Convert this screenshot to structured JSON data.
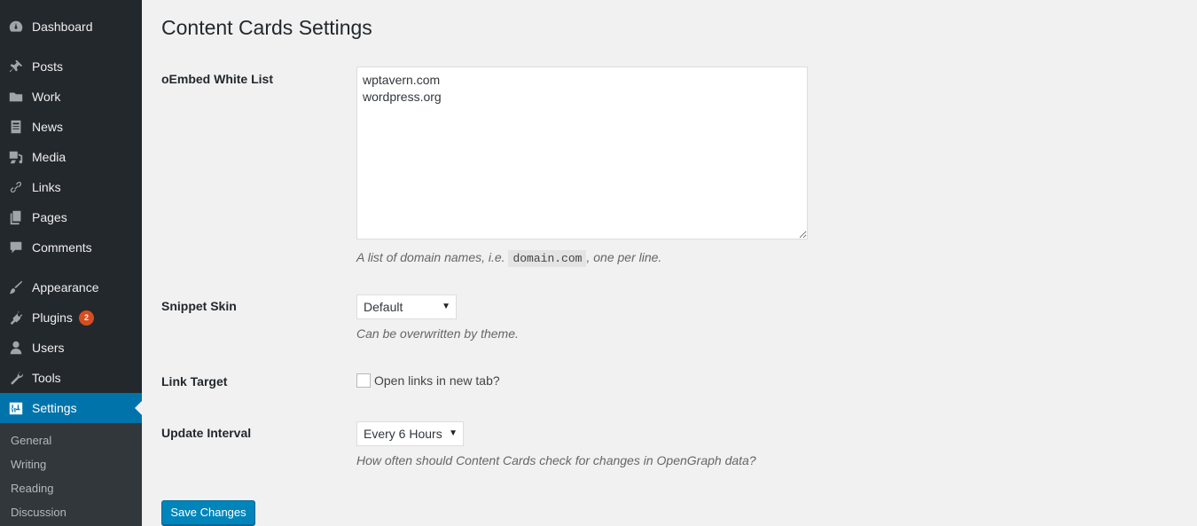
{
  "sidebar": {
    "items": [
      {
        "label": "Dashboard",
        "icon": "dashboard-icon"
      },
      {
        "label": "Posts",
        "icon": "pin-icon"
      },
      {
        "label": "Work",
        "icon": "folder-icon"
      },
      {
        "label": "News",
        "icon": "document-icon"
      },
      {
        "label": "Media",
        "icon": "media-icon"
      },
      {
        "label": "Links",
        "icon": "link-icon"
      },
      {
        "label": "Pages",
        "icon": "pages-icon"
      },
      {
        "label": "Comments",
        "icon": "comment-icon"
      },
      {
        "label": "Appearance",
        "icon": "brush-icon"
      },
      {
        "label": "Plugins",
        "icon": "plug-icon",
        "badge": "2"
      },
      {
        "label": "Users",
        "icon": "user-icon"
      },
      {
        "label": "Tools",
        "icon": "wrench-icon"
      },
      {
        "label": "Settings",
        "icon": "settings-icon",
        "active": true
      }
    ],
    "submenu": [
      "General",
      "Writing",
      "Reading",
      "Discussion"
    ]
  },
  "page": {
    "title": "Content Cards Settings",
    "oembed": {
      "label": "oEmbed White List",
      "value": "wptavern.com\nwordpress.org",
      "desc_before": "A list of domain names, i.e. ",
      "desc_code": "domain.com",
      "desc_after": ", one per line."
    },
    "skin": {
      "label": "Snippet Skin",
      "selected": "Default",
      "desc": "Can be overwritten by theme."
    },
    "link_target": {
      "label": "Link Target",
      "checkbox_label": "Open links in new tab?",
      "checked": false
    },
    "interval": {
      "label": "Update Interval",
      "selected": "Every 6 Hours",
      "desc": "How often should Content Cards check for changes in OpenGraph data?"
    },
    "save_label": "Save Changes"
  },
  "colors": {
    "accent": "#0073aa",
    "button": "#0085ba",
    "sidebar_bg": "#23282d",
    "badge": "#d54e21"
  }
}
